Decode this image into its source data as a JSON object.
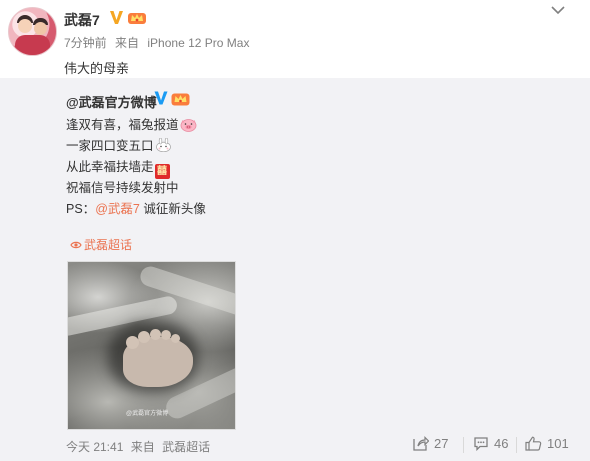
{
  "post": {
    "username": "武磊7",
    "time": "7分钟前",
    "source_prefix": "来自",
    "source": "iPhone 12 Pro Max",
    "text": "伟大的母亲"
  },
  "repost": {
    "author": "@武磊官方微博",
    "lines": [
      "逢双有喜，福兔报道",
      "一家四口变五口",
      "从此幸福扶墙走",
      "祝福信号持续发射中",
      "PS："
    ],
    "ps_mention": "@武磊7",
    "ps_suffix": " 诚征新头像",
    "emoji_xi": "囍",
    "topic_label": "武磊超话",
    "image_watermark": "@武磊官方微博",
    "time": "今天 21:41",
    "source_prefix": "来自",
    "source": "武磊超话",
    "shares": "27",
    "comments": "46",
    "likes": "101"
  },
  "colors": {
    "accent": "#eb7350",
    "verified_blue": "#1a9bf3",
    "repost_bg": "#f2f2f5",
    "meta_gray": "#808080"
  },
  "icons": [
    "chevron-down-icon",
    "verified-v-icon",
    "vip-crown-icon",
    "pig-emoji-icon",
    "rabbit-emoji-icon",
    "topic-icon",
    "share-icon",
    "comment-icon",
    "like-icon"
  ]
}
